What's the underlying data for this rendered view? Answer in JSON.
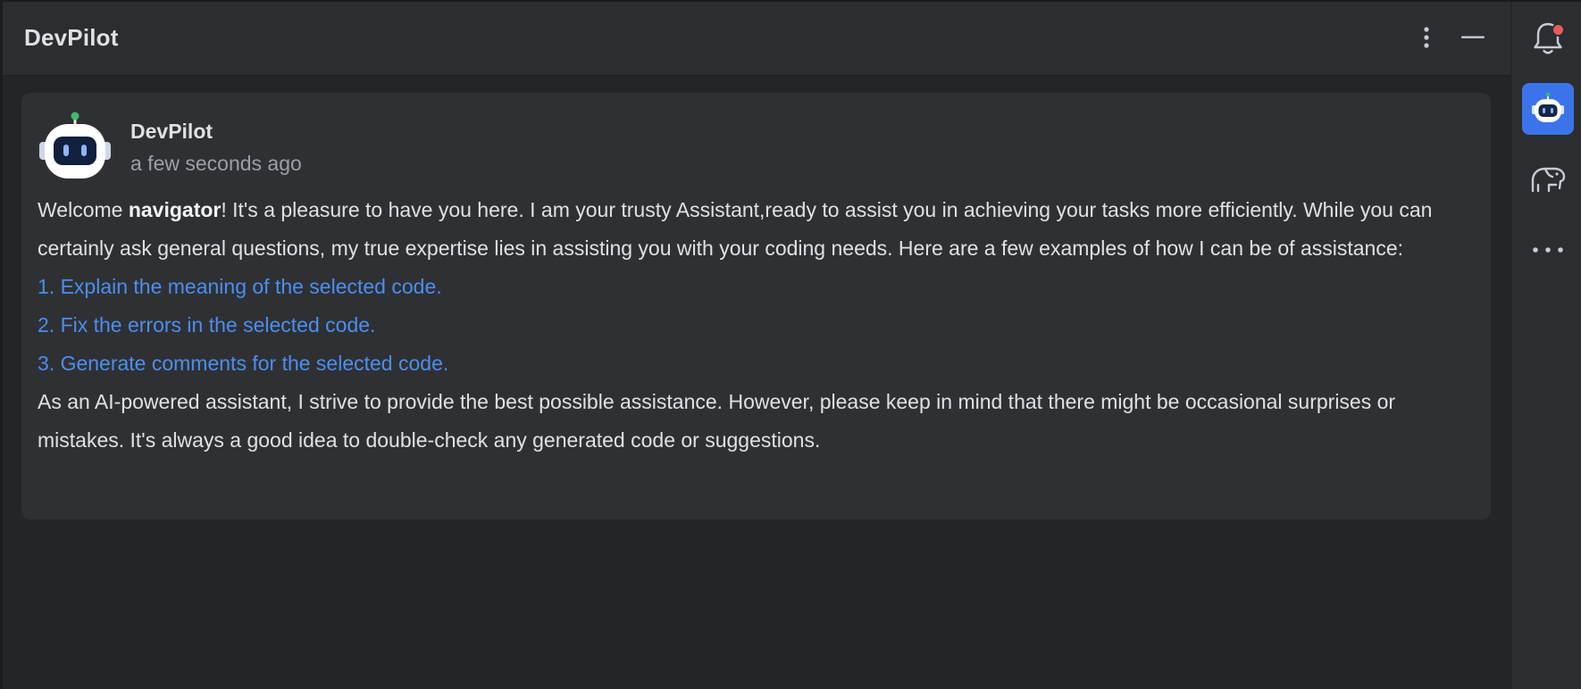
{
  "header": {
    "title": "DevPilot",
    "more_icon": "vertical-ellipsis",
    "minimize_icon": "minus"
  },
  "toolstrip": {
    "items": [
      {
        "icon": "bell-icon",
        "has_notification": true
      },
      {
        "icon": "robot-icon",
        "active": true
      },
      {
        "icon": "elephant-icon"
      },
      {
        "icon": "more-horizontal-icon"
      }
    ]
  },
  "message": {
    "author": "DevPilot",
    "timestamp": "a few seconds ago",
    "intro_prefix": "Welcome ",
    "intro_bold": "navigator",
    "intro_rest": "! It's a pleasure to have you here. I am your trusty Assistant,ready to assist you in achieving your tasks more efficiently. While you can certainly ask general questions, my true expertise lies in assisting you with your coding needs. Here are a few examples of how I can be of assistance:",
    "suggestions": [
      "1. Explain the meaning of the selected code.",
      "2. Fix the errors in the selected code.",
      "3. Generate comments for the selected code."
    ],
    "closing": "As an AI-powered assistant, I strive to provide the best possible assistance. However, please keep in mind that there might be occasional surprises or mistakes. It's always a good idea to double-check any generated code or suggestions."
  },
  "colors": {
    "background": "#242528",
    "card": "#2f3033",
    "link": "#4a8ff0",
    "accent": "#3b74ea",
    "notification": "#e55b57"
  }
}
